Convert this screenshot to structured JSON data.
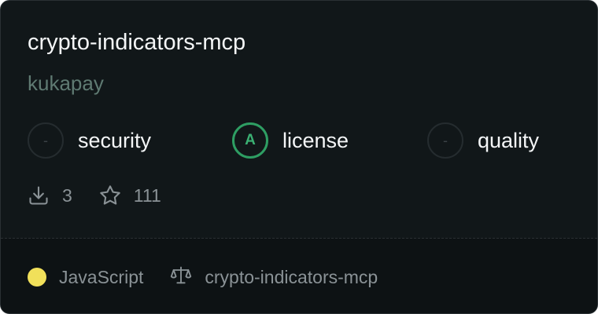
{
  "repo": {
    "name": "crypto-indicators-mcp",
    "owner": "kukapay"
  },
  "scores": [
    {
      "key": "security",
      "grade": "-",
      "label": "security",
      "status": "none"
    },
    {
      "key": "license",
      "grade": "A",
      "label": "license",
      "status": "pass",
      "color": "#2e9e63"
    },
    {
      "key": "quality",
      "grade": "-",
      "label": "quality",
      "status": "none"
    }
  ],
  "stats": {
    "downloads": "3",
    "stars": "111",
    "download_icon": "download-icon",
    "star_icon": "star-icon"
  },
  "footer": {
    "language": "JavaScript",
    "language_color": "#f1e05a",
    "license_name": "crypto-indicators-mcp",
    "license_icon": "scale-icon"
  }
}
